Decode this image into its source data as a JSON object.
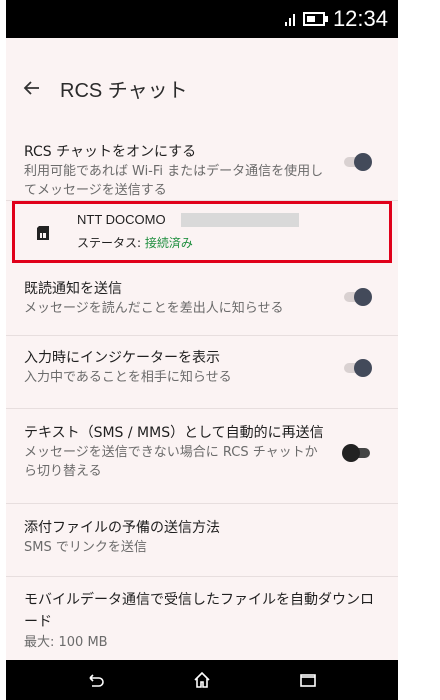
{
  "status": {
    "time": "12:34"
  },
  "appbar": {
    "title": "RCS チャット"
  },
  "rows": {
    "rcs": {
      "title": "RCS チャットをオンにする",
      "desc": "利用可能であれば Wi-Fi またはデータ通信を使用してメッセージを送信する",
      "toggle": "on"
    },
    "sim": {
      "carrier": "NTT DOCOMO",
      "status_prefix": "ステータス: ",
      "status_value": "接続済み"
    },
    "read": {
      "title": "既読通知を送信",
      "desc": "メッセージを読んだことを差出人に知らせる",
      "toggle": "on"
    },
    "typing": {
      "title": "入力時にインジケーターを表示",
      "desc": "入力中であることを相手に知らせる",
      "toggle": "on"
    },
    "resend": {
      "title": "テキスト（SMS / MMS）として自動的に再送信",
      "desc": "メッセージを送信できない場合に RCS チャットから切り替える",
      "toggle": "off"
    },
    "fallback": {
      "title": "添付ファイルの予備の送信方法",
      "desc": "SMS でリンクを送信"
    },
    "download": {
      "title": "モバイルデータ通信で受信したファイルを自動ダウンロード",
      "desc": "最大: 100 MB"
    }
  },
  "colors": {
    "accent": "#434a5a",
    "highlight_border": "#e0001a",
    "connected": "#1e8e3e"
  }
}
